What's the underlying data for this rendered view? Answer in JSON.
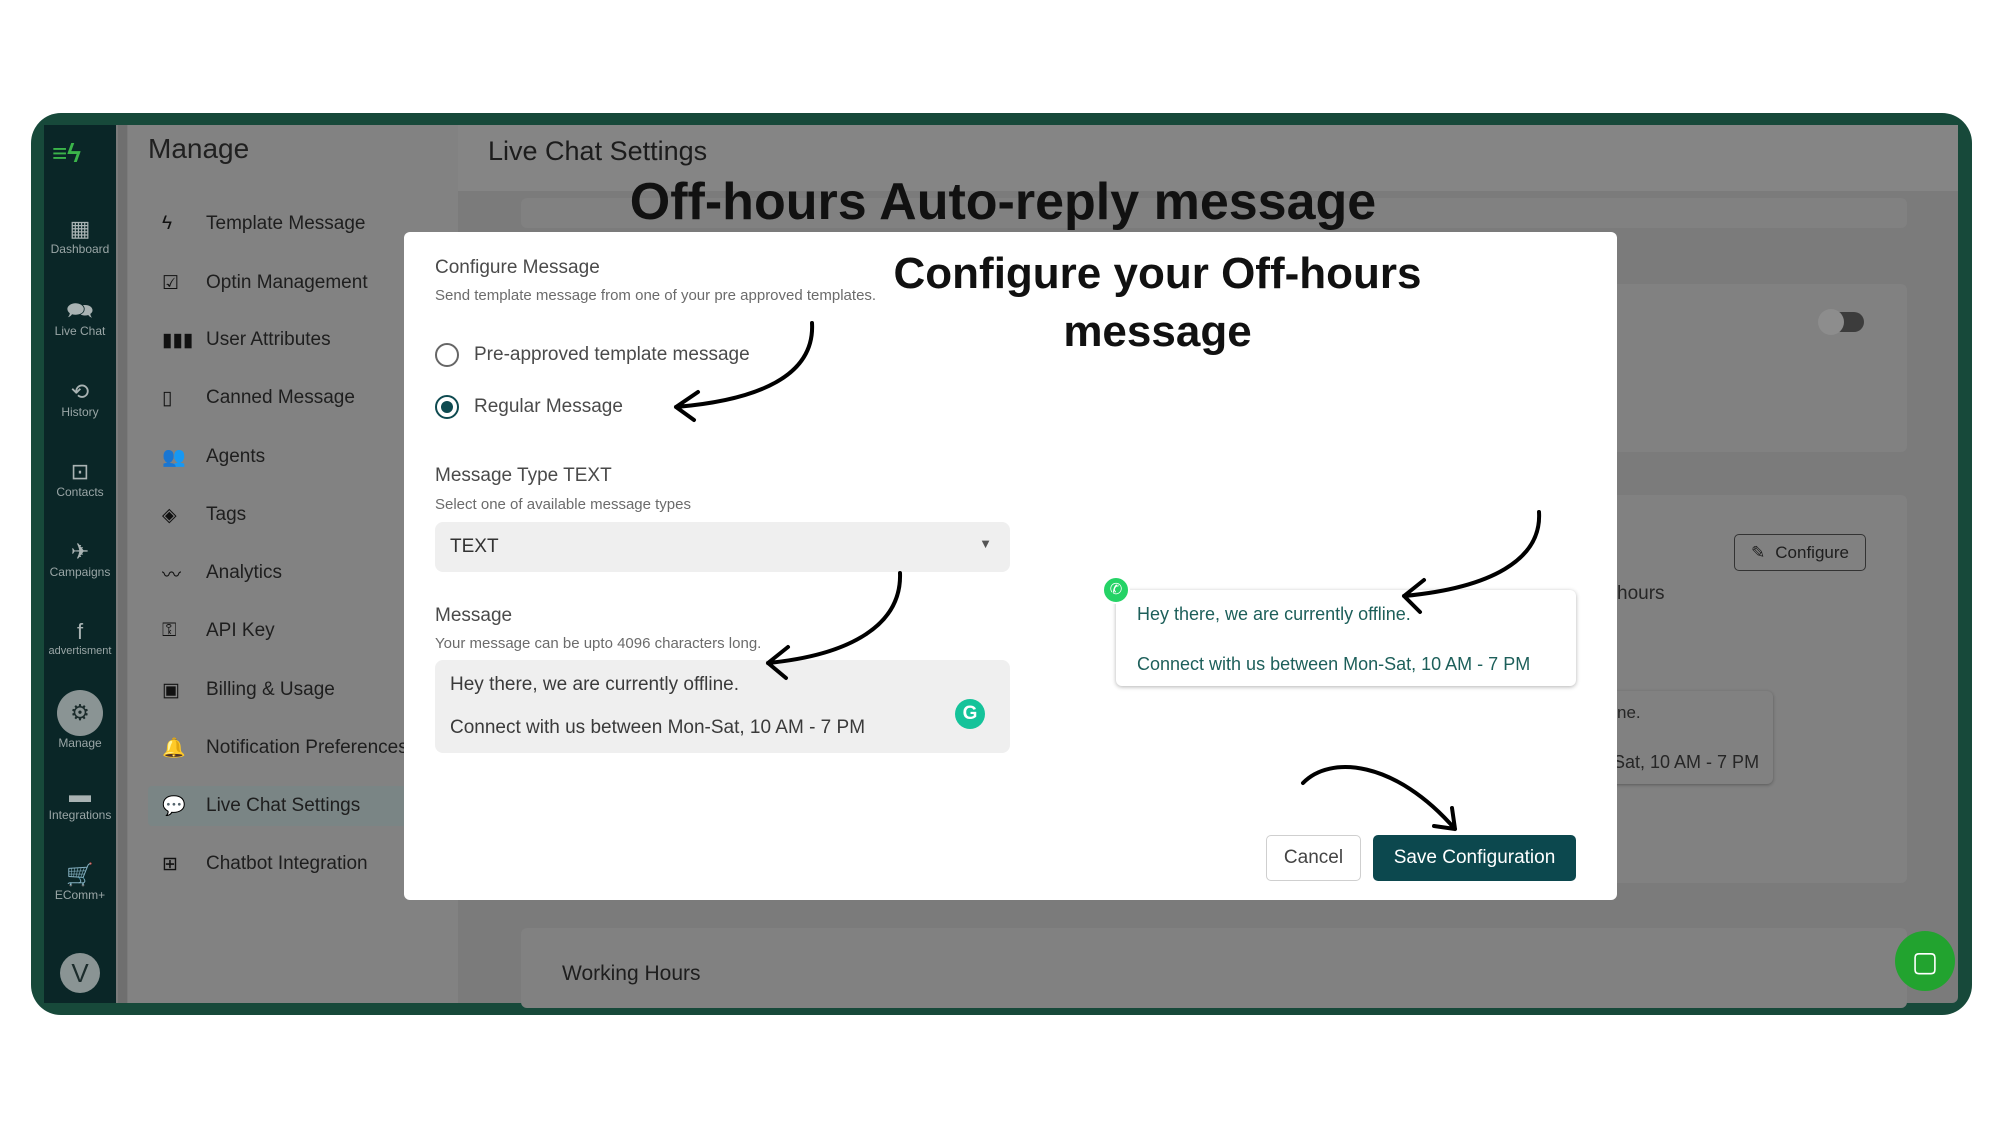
{
  "annotations": {
    "title": "Off-hours Auto-reply message",
    "heading": "Configure your Off-hours message"
  },
  "sidebar": {
    "logo": "logo",
    "items": [
      {
        "label": "Dashboard",
        "icon": "dashboard-icon",
        "glyph": "▦"
      },
      {
        "label": "Live Chat",
        "icon": "chat-icon",
        "glyph": "🗪"
      },
      {
        "label": "History",
        "icon": "history-icon",
        "glyph": "⟲"
      },
      {
        "label": "Contacts",
        "icon": "contacts-icon",
        "glyph": "⊡"
      },
      {
        "label": "Campaigns",
        "icon": "plane-icon",
        "glyph": "✈"
      },
      {
        "label": "advertisment",
        "icon": "facebook-icon",
        "glyph": "f"
      },
      {
        "label": "Manage",
        "icon": "gear-icon",
        "glyph": "⚙"
      },
      {
        "label": "Integrations",
        "icon": "store-icon",
        "glyph": "▬"
      },
      {
        "label": "EComm+",
        "icon": "cart-icon",
        "glyph": "🛒"
      }
    ],
    "avatar": "V"
  },
  "manage": {
    "title": "Manage",
    "items": [
      {
        "label": "Template Message",
        "glyph": "ϟ"
      },
      {
        "label": "Optin Management",
        "glyph": "☑"
      },
      {
        "label": "User Attributes",
        "glyph": "▮▮▮"
      },
      {
        "label": "Canned Message",
        "glyph": "▯"
      },
      {
        "label": "Agents",
        "glyph": "👥"
      },
      {
        "label": "Tags",
        "glyph": "◈"
      },
      {
        "label": "Analytics",
        "glyph": "〰"
      },
      {
        "label": "API Key",
        "glyph": "⚿"
      },
      {
        "label": "Billing & Usage",
        "glyph": "▣"
      },
      {
        "label": "Notification Preferences",
        "glyph": "🔔"
      },
      {
        "label": "Live Chat Settings",
        "glyph": "💬"
      },
      {
        "label": "Chatbot Integration",
        "glyph": "⊞"
      }
    ],
    "active": "Live Chat Settings"
  },
  "main": {
    "title": "Live Chat Settings",
    "configure_label": "Configure",
    "hours_fragment": "hours",
    "bg_line1": "ne.",
    "bg_line2": "Sat, 10 AM - 7 PM",
    "working_hours": "Working Hours"
  },
  "modal": {
    "configure_title": "Configure Message",
    "configure_sub": "Send template message from one of your pre approved templates.",
    "radio_options": [
      {
        "label": "Pre-approved template message",
        "selected": false
      },
      {
        "label": "Regular Message",
        "selected": true
      }
    ],
    "type_title": "Message Type TEXT",
    "type_sub": "Select one of available message types",
    "type_value": "TEXT",
    "message_title": "Message",
    "message_sub": "Your message can be upto 4096 characters long.",
    "message_line1": "Hey there, we are currently offline.",
    "message_line2": "Connect with us between Mon-Sat, 10 AM - 7 PM",
    "preview_line1": "Hey there, we are currently offline.",
    "preview_line2": "Connect with us between Mon-Sat, 10 AM - 7 PM",
    "cancel": "Cancel",
    "save": "Save Configuration"
  },
  "colors": {
    "brand": "#0c484e",
    "frame": "#17493a",
    "whatsapp": "#25d366",
    "grammarly": "#15c39a"
  }
}
